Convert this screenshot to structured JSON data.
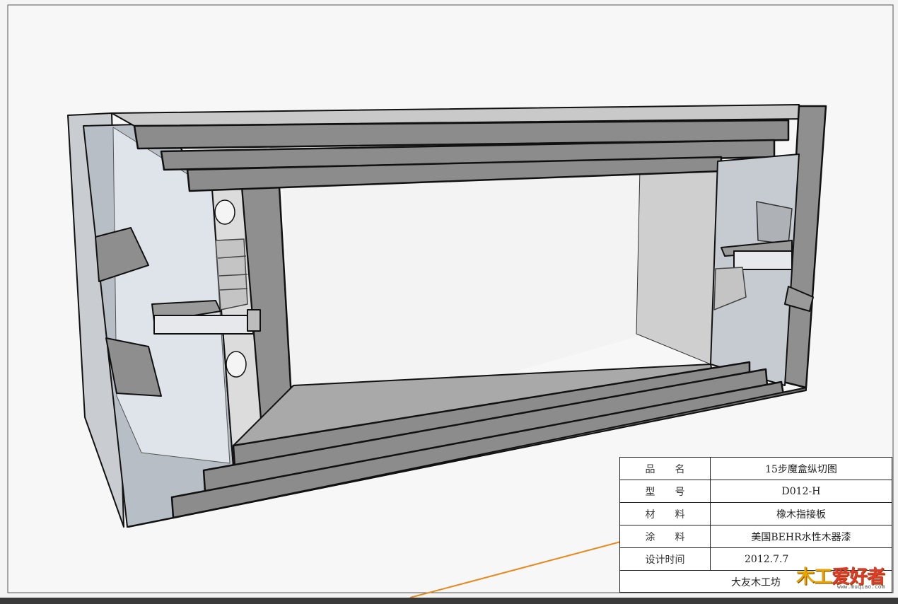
{
  "title_block": {
    "rows": [
      {
        "label": "品　　名",
        "value": "15步魔盒纵切图"
      },
      {
        "label": "型　　号",
        "value": "D012-H"
      },
      {
        "label": "材　　料",
        "value": "橡木指接板"
      },
      {
        "label": "涂　　料",
        "value": "美国BEHR水性木器漆"
      },
      {
        "label": "设计时间",
        "value": "2012.7.7"
      }
    ],
    "footer": "大友木工坊"
  },
  "logo": {
    "text_a": "木工",
    "text_b": "爱好者",
    "url": "www.muqiao.com"
  },
  "colors": {
    "face_dark": "#8a8a8a",
    "face_mid": "#a8a8a8",
    "face_light": "#c8c8c8",
    "glass": "#dde3ea",
    "edge": "#111111",
    "accent_line": "#e58a1f"
  }
}
